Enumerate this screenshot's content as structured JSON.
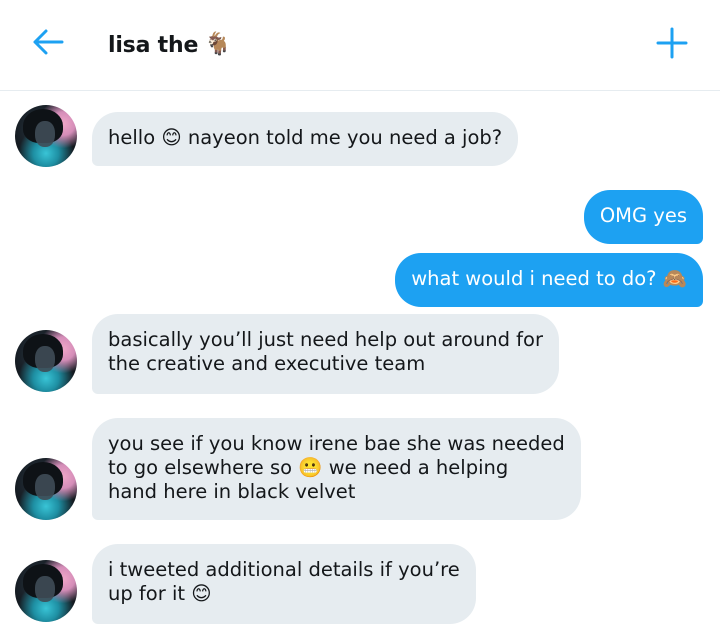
{
  "header": {
    "back_icon": "arrow-left-icon",
    "title": "lisa the",
    "title_emoji": "🐐",
    "add_icon": "plus-icon",
    "accent_color": "#1da1f2"
  },
  "messages": [
    {
      "from": "them",
      "text": "hello 😊 nayeon told me you need a job?"
    },
    {
      "from": "me",
      "text": "OMG yes"
    },
    {
      "from": "me",
      "text": "what would i need to do? 🙈"
    },
    {
      "from": "them",
      "text": "basically you’ll just need help out around for\nthe creative and executive team"
    },
    {
      "from": "them",
      "text": "you see if you know irene bae she was needed\nto go elsewhere so 😬 we need a helping\nhand here in black velvet"
    },
    {
      "from": "them",
      "text": "i tweeted additional details if you’re\nup for it 😊"
    }
  ],
  "colors": {
    "sent_bubble": "#1da1f2",
    "received_bubble": "#e6ecf0"
  }
}
